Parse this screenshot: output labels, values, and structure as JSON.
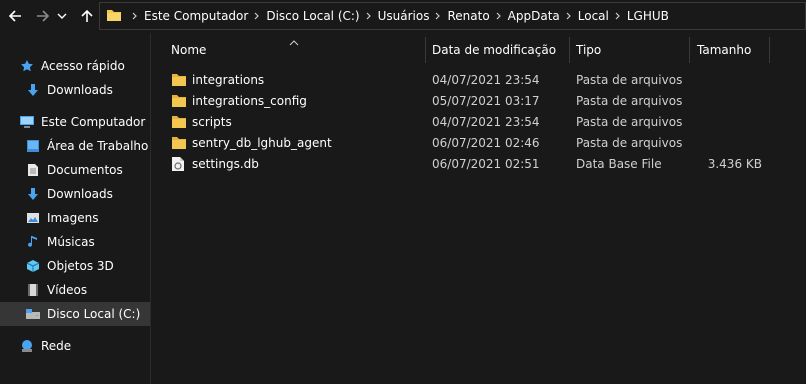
{
  "nav": {
    "back": "back-arrow-icon",
    "forward": "forward-arrow-icon",
    "recent": "chevron-down-icon",
    "up": "up-arrow-icon"
  },
  "breadcrumb": [
    "Este Computador",
    "Disco Local (C:)",
    "Usuários",
    "Renato",
    "AppData",
    "Local",
    "LGHUB"
  ],
  "sidebar": {
    "quick_access": "Acesso rápido",
    "quick_items": [
      {
        "label": "Downloads",
        "icon": "download-arrow-icon"
      }
    ],
    "this_pc": "Este Computador",
    "pc_items": [
      {
        "label": "Área de Trabalho",
        "icon": "desktop-icon"
      },
      {
        "label": "Documentos",
        "icon": "document-icon"
      },
      {
        "label": "Downloads",
        "icon": "download-arrow-icon"
      },
      {
        "label": "Imagens",
        "icon": "pictures-icon"
      },
      {
        "label": "Músicas",
        "icon": "music-note-icon"
      },
      {
        "label": "Objetos 3D",
        "icon": "cube-icon"
      },
      {
        "label": "Vídeos",
        "icon": "video-icon"
      },
      {
        "label": "Disco Local (C:)",
        "icon": "drive-icon"
      }
    ],
    "network": "Rede"
  },
  "columns": {
    "name": "Nome",
    "date": "Data de modificação",
    "type": "Tipo",
    "size": "Tamanho"
  },
  "files": [
    {
      "name": "integrations",
      "date": "04/07/2021 23:54",
      "type": "Pasta de arquivos",
      "size": "",
      "icon": "folder-icon"
    },
    {
      "name": "integrations_config",
      "date": "05/07/2021 03:17",
      "type": "Pasta de arquivos",
      "size": "",
      "icon": "folder-icon"
    },
    {
      "name": "scripts",
      "date": "04/07/2021 23:54",
      "type": "Pasta de arquivos",
      "size": "",
      "icon": "folder-icon"
    },
    {
      "name": "sentry_db_lghub_agent",
      "date": "06/07/2021 02:46",
      "type": "Pasta de arquivos",
      "size": "",
      "icon": "folder-icon"
    },
    {
      "name": "settings.db",
      "date": "06/07/2021 02:51",
      "type": "Data Base File",
      "size": "3.436 KB",
      "icon": "db-file-icon"
    }
  ],
  "colors": {
    "background": "#191919",
    "selected": "#363636",
    "folder": "#f3c74f",
    "accent_blue": "#4aa3f0"
  }
}
